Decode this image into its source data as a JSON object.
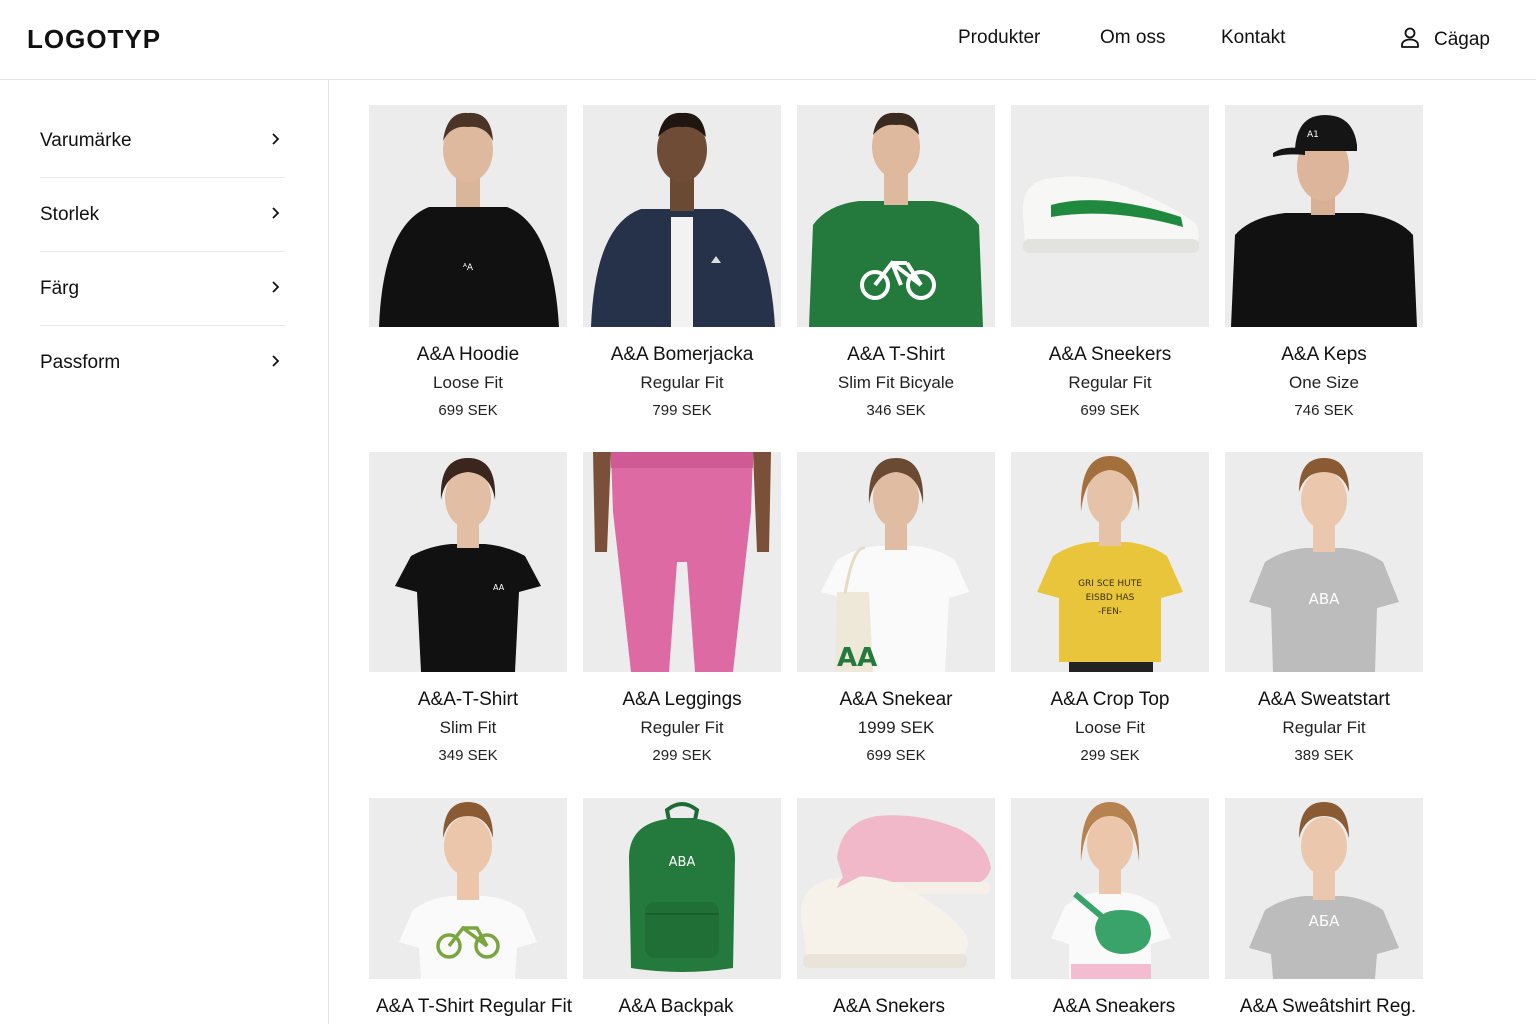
{
  "header": {
    "logo": "LOGOTYP",
    "nav": [
      "Produkter",
      "Om oss",
      "Kontakt"
    ],
    "user_label": "Cägap"
  },
  "sidebar": {
    "filters": [
      "Varumärke",
      "Storlek",
      "Färg",
      "Passform"
    ]
  },
  "colors": {
    "black": "#111111",
    "navy": "#26324a",
    "green": "#237a3c",
    "pink": "#de6aa3",
    "yellow": "#e9c53c",
    "grey": "#bcbcbc",
    "white": "#f7f7f7"
  },
  "products": [
    {
      "name": "A&A Hoodie",
      "sub": "Loose Fit",
      "price": "699 SEK"
    },
    {
      "name": "A&A Bomerjacka",
      "sub": "Regular Fit",
      "price": "799 SEK"
    },
    {
      "name": "A&A T-Shirt",
      "sub": "Slim Fit Bicyale",
      "price": "346 SEK"
    },
    {
      "name": "A&A Sneekers",
      "sub": "Regular Fit",
      "price": "699 SEK"
    },
    {
      "name": "A&A Keps",
      "sub": "One Size",
      "price": "746 SEK"
    },
    {
      "name": "A&A-T-Shirt",
      "sub": "Slim Fit",
      "price": "349 SEK"
    },
    {
      "name": "A&A Leggings",
      "sub": "Reguler Fit",
      "price": "299 SEK"
    },
    {
      "name": "A&A Snekear",
      "sub": "1999 SEK",
      "price": "699 SEK"
    },
    {
      "name": "A&A Crop Top",
      "sub": "Loose Fit",
      "price": "299 SEK"
    },
    {
      "name": "A&A Sweatstart",
      "sub": "Regular Fit",
      "price": "389 SEK"
    },
    {
      "name": "A&A T-Shirt Regular Fit",
      "sub": "",
      "price": ""
    },
    {
      "name": "A&A Backpak",
      "sub": "",
      "price": ""
    },
    {
      "name": "A&A Snekers",
      "sub": "",
      "price": ""
    },
    {
      "name": "A&A Sneakers",
      "sub": "",
      "price": ""
    },
    {
      "name": "A&A Sweâtshirt Reg.",
      "sub": "",
      "price": ""
    }
  ],
  "images": [
    {
      "kind": "hoodie-model-photo",
      "color": "#111111"
    },
    {
      "kind": "bomber-jacket-model-photo",
      "color": "#26324a"
    },
    {
      "kind": "bicycle-tshirt-model-photo",
      "color": "#237a3c"
    },
    {
      "kind": "sneaker-photo",
      "color": "#f5f5f3"
    },
    {
      "kind": "cap-model-photo",
      "color": "#111111"
    },
    {
      "kind": "tshirt-model-photo",
      "color": "#111111"
    },
    {
      "kind": "leggings-photo",
      "color": "#de6aa3"
    },
    {
      "kind": "tote-bag-model-photo",
      "color": "#f7f7f7"
    },
    {
      "kind": "crop-top-model-photo",
      "color": "#e9c53c"
    },
    {
      "kind": "sweatshirt-model-photo",
      "color": "#bcbcbc"
    },
    {
      "kind": "bicycle-tshirt-kid-photo",
      "color": "#f7f7f7"
    },
    {
      "kind": "backpack-photo",
      "color": "#237a3c"
    },
    {
      "kind": "pink-sneakers-photo",
      "color": "#f0b8c8"
    },
    {
      "kind": "belt-bag-kid-photo",
      "color": "#3aa36a"
    },
    {
      "kind": "sweatshirt-kid-photo",
      "color": "#bcbcbc"
    }
  ]
}
